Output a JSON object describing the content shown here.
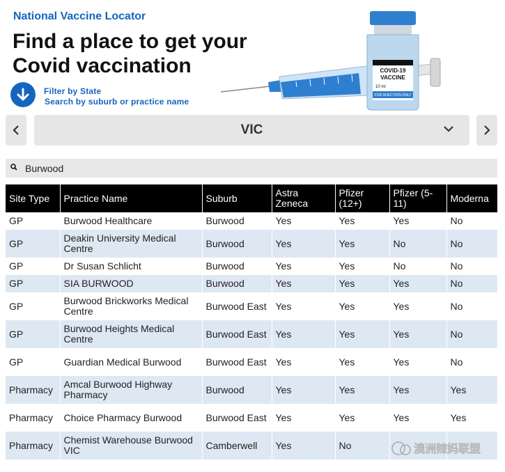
{
  "header": {
    "eyebrow": "National Vaccine Locator",
    "headline": "Find a place to get your Covid vaccination",
    "filter_state": "Filter by State",
    "filter_search": "Search by suburb or practice name"
  },
  "hero": {
    "vial_line1": "COVID-19",
    "vial_line2": "VACCINE",
    "vial_volume": "10 ml",
    "vial_footer": "FOR INJECTION ONLY"
  },
  "state_selector": {
    "selected": "VIC"
  },
  "search": {
    "value": "Burwood"
  },
  "table": {
    "columns": [
      "Site Type",
      "Practice Name",
      "Suburb",
      "Astra Zeneca",
      "Pfizer (12+)",
      "Pfizer (5-11)",
      "Moderna"
    ],
    "rows": [
      [
        "GP",
        "Burwood Healthcare",
        "Burwood",
        "Yes",
        "Yes",
        "Yes",
        "No"
      ],
      [
        "GP",
        "Deakin University Medical Centre",
        "Burwood",
        "Yes",
        "Yes",
        "No",
        "No"
      ],
      [
        "GP",
        "Dr Susan Schlicht",
        "Burwood",
        "Yes",
        "Yes",
        "No",
        "No"
      ],
      [
        "GP",
        "SIA BURWOOD",
        "Burwood",
        "Yes",
        "Yes",
        "Yes",
        "No"
      ],
      [
        "GP",
        "Burwood Brickworks Medical Centre",
        "Burwood East",
        "Yes",
        "Yes",
        "Yes",
        "No"
      ],
      [
        "GP",
        "Burwood Heights Medical Centre",
        "Burwood East",
        "Yes",
        "Yes",
        "Yes",
        "No"
      ],
      [
        "GP",
        "Guardian Medical Burwood",
        "Burwood East",
        "Yes",
        "Yes",
        "Yes",
        "No"
      ],
      [
        "Pharmacy",
        "Amcal Burwood Highway Pharmacy",
        "Burwood",
        "Yes",
        "Yes",
        "Yes",
        "Yes"
      ],
      [
        "Pharmacy",
        "Choice Pharmacy Burwood",
        "Burwood East",
        "Yes",
        "Yes",
        "Yes",
        "Yes"
      ],
      [
        "Pharmacy",
        "Chemist Warehouse Burwood VIC",
        "Camberwell",
        "Yes",
        "No",
        "",
        ""
      ]
    ]
  },
  "watermark": {
    "text": "澳洲辣妈联盟"
  },
  "colors": {
    "accent": "#1565c0",
    "header_bg": "#000000",
    "row_alt": "#dde8f3",
    "control_bg": "#e6e6e6"
  },
  "icons": {
    "down": "arrow-down-circle-icon",
    "prev": "chevron-left-icon",
    "next": "chevron-right-icon",
    "dropdown": "chevron-down-icon",
    "search": "search-icon"
  }
}
